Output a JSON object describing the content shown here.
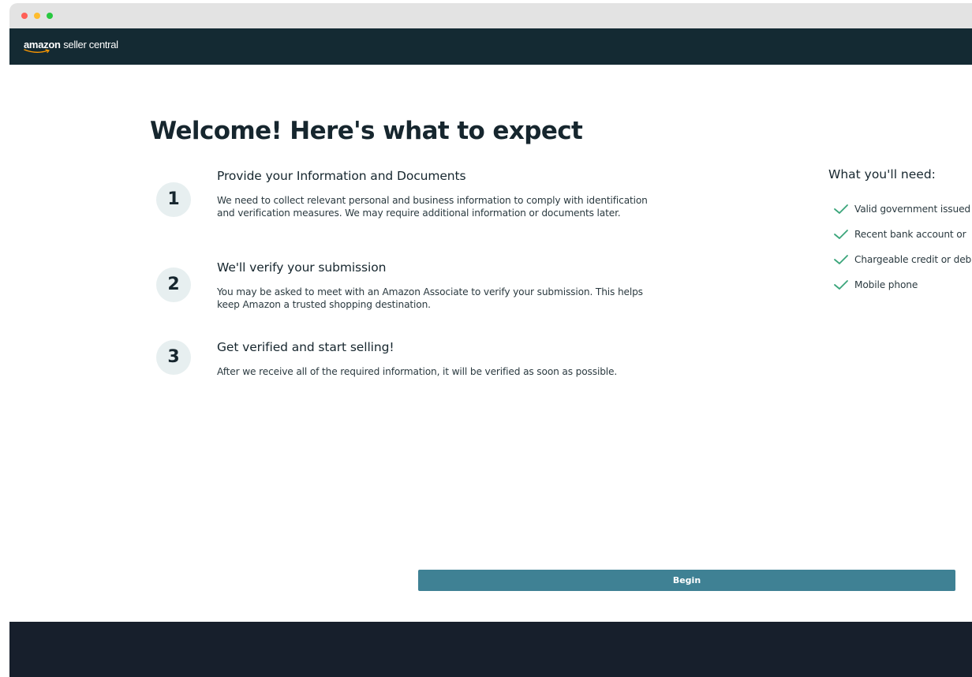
{
  "header": {
    "logo_brand": "amazon",
    "logo_product": "seller central",
    "background_color": "#142a33"
  },
  "main": {
    "title": "Welcome! Here's what to expect",
    "steps": [
      {
        "number": "1",
        "title": "Provide your Information and Documents",
        "description": "We need to collect relevant personal and business information to comply with identification and verification measures. We may require additional information or documents later."
      },
      {
        "number": "2",
        "title": "We'll verify your submission",
        "description": "You may be asked to meet with an Amazon Associate to verify your submission. This helps keep Amazon a trusted shopping destination."
      },
      {
        "number": "3",
        "title": "Get verified and start selling!",
        "description": "After we receive all of the required information, it will be verified as soon as possible."
      }
    ]
  },
  "needs": {
    "title": "What you'll need:",
    "items": [
      {
        "icon": "check-icon",
        "label": "Valid government issued"
      },
      {
        "icon": "check-icon",
        "label": "Recent bank account or"
      },
      {
        "icon": "check-icon",
        "label": "Chargeable credit or debit"
      },
      {
        "icon": "check-icon",
        "label": "Mobile phone"
      }
    ],
    "check_color": "#3aa57a"
  },
  "actions": {
    "begin_label": "Begin",
    "begin_color": "#3f8194"
  },
  "footer": {
    "background_color": "#171f2c"
  }
}
